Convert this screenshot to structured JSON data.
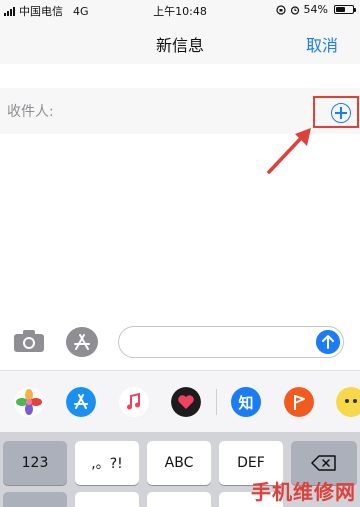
{
  "status_bar": {
    "carrier": "中国电信",
    "network": "4G",
    "time": "上午10:48",
    "battery": "54%",
    "battery_level": 0.54
  },
  "nav": {
    "title": "新信息",
    "cancel": "取消"
  },
  "recipient": {
    "label": "收件人:"
  },
  "message": {
    "placeholder": "",
    "value": ""
  },
  "app_drawer": {
    "apps": [
      "photos-app",
      "app-store-app",
      "music-app",
      "heart-app",
      "zhihu-app",
      "flag-app",
      "more-app"
    ],
    "zhihu_text": "知"
  },
  "keyboard": {
    "keys": [
      "123",
      ",。?!",
      "ABC",
      "DEF"
    ]
  },
  "watermark": "手机维修网",
  "colors": {
    "accent": "#1a7cf6",
    "highlight": "#e0403a"
  }
}
